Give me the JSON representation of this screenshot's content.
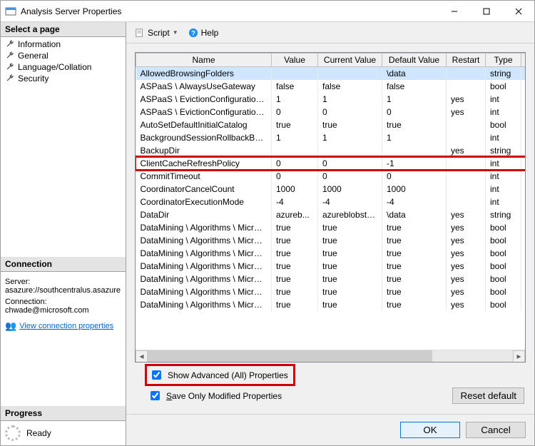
{
  "window": {
    "title": "Analysis Server Properties"
  },
  "toolbar": {
    "script_label": "Script",
    "help_label": "Help"
  },
  "sidebar": {
    "select_page_header": "Select a page",
    "pages": [
      "Information",
      "General",
      "Language/Collation",
      "Security"
    ],
    "connection_header": "Connection",
    "server_label": "Server:",
    "server_value": "asazure://southcentralus.asazure.",
    "connection_label": "Connection:",
    "connection_value": "chwade@microsoft.com",
    "view_props_link": "View connection properties",
    "progress_header": "Progress",
    "progress_status": "Ready"
  },
  "grid": {
    "columns": [
      "Name",
      "Value",
      "Current Value",
      "Default Value",
      "Restart",
      "Type"
    ],
    "rows": [
      {
        "name": "AllowedBrowsingFolders",
        "value": "",
        "current": "",
        "def": "\\data",
        "restart": "",
        "type": "string",
        "selected": true
      },
      {
        "name": "ASPaaS \\ AlwaysUseGateway",
        "value": "false",
        "current": "false",
        "def": "false",
        "restart": "",
        "type": "bool"
      },
      {
        "name": "ASPaaS \\ EvictionConfiguration \\ ...",
        "value": "1",
        "current": "1",
        "def": "1",
        "restart": "yes",
        "type": "int"
      },
      {
        "name": "ASPaaS \\ EvictionConfiguration \\ ...",
        "value": "0",
        "current": "0",
        "def": "0",
        "restart": "yes",
        "type": "int"
      },
      {
        "name": "AutoSetDefaultInitialCatalog",
        "value": "true",
        "current": "true",
        "def": "true",
        "restart": "",
        "type": "bool"
      },
      {
        "name": "BackgroundSessionRollbackBatch...",
        "value": "1",
        "current": "1",
        "def": "1",
        "restart": "",
        "type": "int"
      },
      {
        "name": "BackupDir",
        "value": "",
        "current": "",
        "def": "",
        "restart": "yes",
        "type": "string"
      },
      {
        "name": "ClientCacheRefreshPolicy",
        "value": "0",
        "current": "0",
        "def": "-1",
        "restart": "",
        "type": "int",
        "highlight": true
      },
      {
        "name": "CommitTimeout",
        "value": "0",
        "current": "0",
        "def": "0",
        "restart": "",
        "type": "int"
      },
      {
        "name": "CoordinatorCancelCount",
        "value": "1000",
        "current": "1000",
        "def": "1000",
        "restart": "",
        "type": "int"
      },
      {
        "name": "CoordinatorExecutionMode",
        "value": "-4",
        "current": "-4",
        "def": "-4",
        "restart": "",
        "type": "int"
      },
      {
        "name": "DataDir",
        "value": "azureb...",
        "current": "azureblobstor...",
        "def": "\\data",
        "restart": "yes",
        "type": "string"
      },
      {
        "name": "DataMining \\ Algorithms \\ Microsof...",
        "value": "true",
        "current": "true",
        "def": "true",
        "restart": "yes",
        "type": "bool"
      },
      {
        "name": "DataMining \\ Algorithms \\ Microsof...",
        "value": "true",
        "current": "true",
        "def": "true",
        "restart": "yes",
        "type": "bool"
      },
      {
        "name": "DataMining \\ Algorithms \\ Microsof...",
        "value": "true",
        "current": "true",
        "def": "true",
        "restart": "yes",
        "type": "bool"
      },
      {
        "name": "DataMining \\ Algorithms \\ Microsof...",
        "value": "true",
        "current": "true",
        "def": "true",
        "restart": "yes",
        "type": "bool"
      },
      {
        "name": "DataMining \\ Algorithms \\ Microsof...",
        "value": "true",
        "current": "true",
        "def": "true",
        "restart": "yes",
        "type": "bool"
      },
      {
        "name": "DataMining \\ Algorithms \\ Microsof...",
        "value": "true",
        "current": "true",
        "def": "true",
        "restart": "yes",
        "type": "bool"
      },
      {
        "name": "DataMining \\ Algorithms \\ Microsof...",
        "value": "true",
        "current": "true",
        "def": "true",
        "restart": "yes",
        "type": "bool"
      }
    ]
  },
  "options": {
    "show_advanced_prefix": "S",
    "show_advanced_rest": "how Advanced (All) Properties",
    "save_modified_prefix": "S",
    "save_modified_rest": "ave Only Modified Properties",
    "reset_default": "Reset default"
  },
  "footer": {
    "ok": "OK",
    "cancel": "Cancel"
  }
}
